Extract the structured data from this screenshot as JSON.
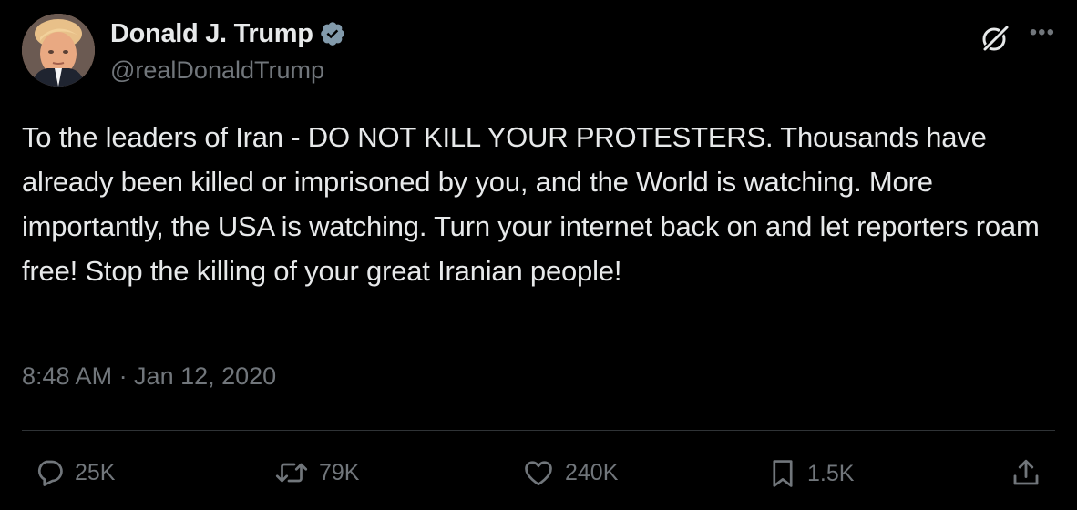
{
  "author": {
    "display_name": "Donald J. Trump",
    "handle": "@realDonaldTrump",
    "verified_color": "#829aab"
  },
  "tweet": {
    "text": "To the leaders of Iran - DO NOT KILL YOUR PROTESTERS. Thousands have already been killed or imprisoned by you, and the World is watching. More importantly, the USA is watching. Turn your internet back on and let reporters roam free! Stop the killing of your great Iranian people!",
    "timestamp": "8:48 AM · Jan 12, 2020"
  },
  "actions": {
    "replies": "25K",
    "reposts": "79K",
    "likes": "240K",
    "bookmarks": "1.5K"
  },
  "icons": {
    "reply": "reply-icon",
    "repost": "repost-icon",
    "like": "heart-icon",
    "bookmark": "bookmark-icon",
    "share": "share-icon",
    "grok": "grok-icon",
    "more": "more-icon",
    "verified": "verified-badge-icon"
  },
  "colors": {
    "background": "#000000",
    "text": "#e7e9ea",
    "secondary": "#71767b",
    "divider": "#2f3336"
  }
}
